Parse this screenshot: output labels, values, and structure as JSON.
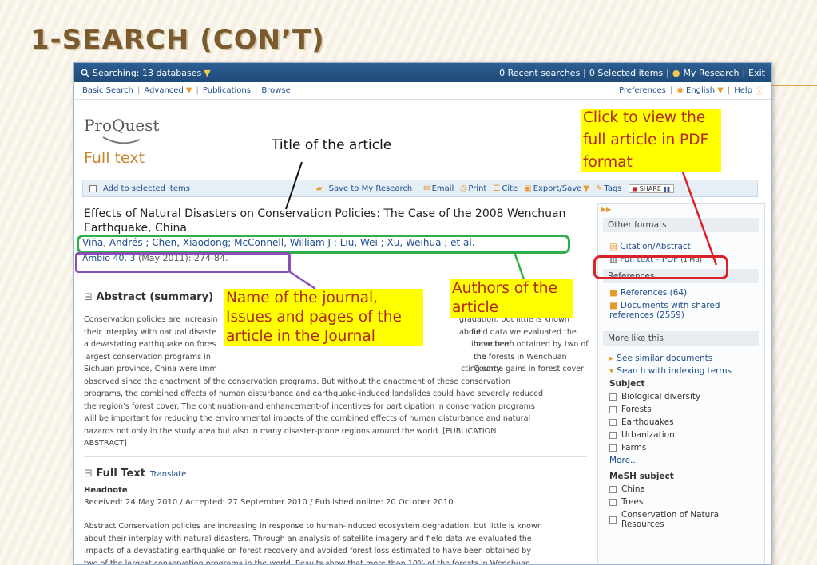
{
  "slide": {
    "title": "1-SEARCH (CON’T)"
  },
  "topbar": {
    "searching_label": "Searching:",
    "databases_link": "13 databases",
    "recent": "0 Recent searches",
    "selected": "0 Selected items",
    "my_research": "My Research",
    "exit": "Exit"
  },
  "nav": {
    "basic": "Basic Search",
    "advanced": "Advanced",
    "publications": "Publications",
    "browse": "Browse",
    "preferences": "Preferences",
    "language": "English",
    "help": "Help"
  },
  "page": {
    "logo": "ProQuest",
    "heading": "Full text"
  },
  "toolbar": {
    "add": "Add to selected items",
    "save": "Save to My Research",
    "email": "Email",
    "print": "Print",
    "cite": "Cite",
    "export": "Export/Save",
    "tags": "Tags",
    "share": "SHARE"
  },
  "article": {
    "title": "Effects of Natural Disasters on Conservation Policies: The Case of the 2008 Wenchuan Earthquake, China",
    "authors": "Viña, Andrés ; Chen, Xiaodong; McConnell, William J ; Liu, Wei ; Xu, Weihua ; et al.",
    "journal_link": "Ambio 40. 3",
    "journal_rest": "(May 2011): 274-84.",
    "abstract_heading": "Abstract (summary)",
    "abstract_lines": [
      "Conservation policies are increasin",
      "their interplay with natural disaste",
      "a devastating earthquake on fores",
      "largest conservation programs in",
      "Sichuan province, China were imm",
      "observed since the enactment of the conservation programs. But without the enactment of these conservation",
      "programs, the combined effects of human disturbance and earthquake-induced landslides could have severely reduced",
      "the region's forest cover. The continuation-and enhancement-of incentives for participation in conservation programs",
      "will be important for reducing the environmental impacts of the combined effects of human disturbance and natural",
      "hazards not only in the study area but also in many disaster-prone regions around the world. [PUBLICATION",
      "ABSTRACT]"
    ],
    "abstract_tails": [
      "gradation, but little is known about",
      "field data we evaluated the impacts of",
      "have been obtained by two of the",
      "the forests in Wenchuan County,",
      "cting some gains in forest cover"
    ],
    "fulltext_heading": "Full Text",
    "translate": "Translate",
    "headnote": "Headnote",
    "received": "Received: 24 May 2010 / Accepted: 27 September 2010 / Published online: 20 October 2010",
    "fulltext_lines": [
      "Abstract Conservation policies are increasing in response to human-induced ecosystem degradation, but little is known",
      "about their interplay with natural disasters. Through an analysis of satellite imagery and field data we evaluated the",
      "impacts of a devastating earthquake on forest recovery and avoided forest loss estimated to have been obtained by",
      "two of the largest conservation programs in the world. Results show that more than 10% of the forests in Wenchuan"
    ]
  },
  "sidebar": {
    "other_formats": "Other formats",
    "citation": "Citation/Abstract",
    "fulltext_pdf": "Full text - PDF",
    "pdf_size": "(1 MB)",
    "references_head": "References",
    "references": "References (64)",
    "shared": "Documents with shared references (2559)",
    "more_like": "More like this",
    "similar": "See similar documents",
    "indexing": "Search with indexing terms",
    "subject_head": "Subject",
    "subjects": [
      "Biological diversity",
      "Forests",
      "Earthquakes",
      "Urbanization",
      "Farms"
    ],
    "more": "More...",
    "mesh_head": "MeSH subject",
    "mesh": [
      "China",
      "Trees",
      "Conservation of Natural Resources"
    ]
  },
  "annotations": {
    "title_label": "Title of the article",
    "pdf_label_1": "Click to view the",
    "pdf_label_2": "full article in PDF",
    "pdf_label_3": "format",
    "authors_label_1": "Authors of the",
    "authors_label_2": "article",
    "journal_label_1": "Name of the journal,",
    "journal_label_2": "Issues and pages of the",
    "journal_label_3": "article in the Journal"
  },
  "colors": {
    "highlight": "#ffff00",
    "anno_text": "#b3271f",
    "green_ring": "#2fae4a",
    "purple_ring": "#8a4fb5",
    "red_ring": "#d8232a"
  }
}
